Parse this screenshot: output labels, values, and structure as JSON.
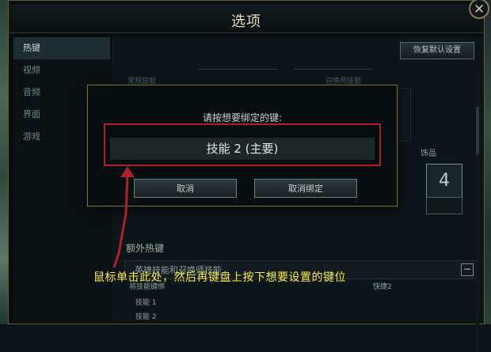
{
  "window": {
    "title": "选项",
    "close_icon": "close-icon"
  },
  "sidebar": {
    "items": [
      {
        "label": "热键",
        "active": true
      },
      {
        "label": "视频",
        "active": false
      },
      {
        "label": "音频",
        "active": false
      },
      {
        "label": "界面",
        "active": false
      },
      {
        "label": "游戏",
        "active": false
      }
    ]
  },
  "content": {
    "reset_button": "恢复默认设置",
    "columns": [
      "常规技能",
      "召唤师技能"
    ],
    "accessory_label": "饰品",
    "accessory_key": "4",
    "extra_title": "额外热键",
    "section_title": "英雄技能和召唤师技能",
    "section_sub_left": "将技能键绑",
    "section_sub_right": "快捷2",
    "rows": [
      "技能 1",
      "技能 2"
    ]
  },
  "dialog": {
    "prompt": "请按想要绑定的键:",
    "binding_target": "技能 2 (主要)",
    "cancel_button": "取消",
    "unbind_button": "取消绑定"
  },
  "annotation": {
    "text": "鼠标单击此处，然后再键盘上按下想要设置的键位",
    "arrow_color": "#b0202a",
    "text_color": "#ffeb3b"
  }
}
